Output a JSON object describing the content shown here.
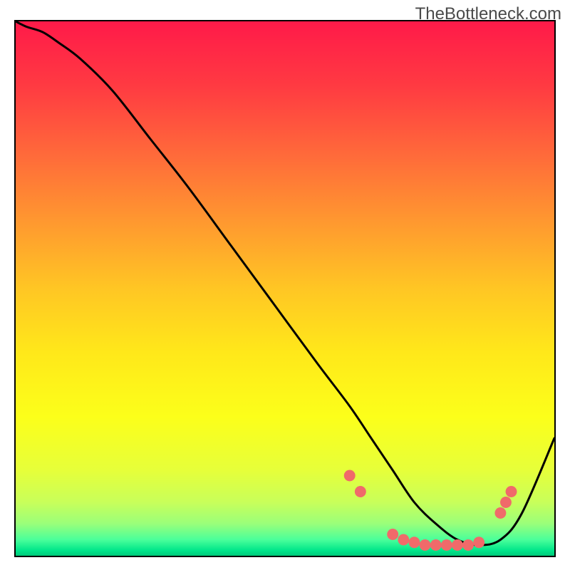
{
  "watermark": "TheBottleneck.com",
  "chart_data": {
    "type": "line",
    "title": "",
    "xlabel": "",
    "ylabel": "",
    "xlim": [
      0,
      100
    ],
    "ylim": [
      0,
      100
    ],
    "gradient_stops": [
      {
        "pos": 0,
        "color": "#ff1a49"
      },
      {
        "pos": 12,
        "color": "#ff3a42"
      },
      {
        "pos": 25,
        "color": "#ff6a3a"
      },
      {
        "pos": 38,
        "color": "#ff9a2f"
      },
      {
        "pos": 50,
        "color": "#ffc624"
      },
      {
        "pos": 62,
        "color": "#ffe81a"
      },
      {
        "pos": 74,
        "color": "#fcff1a"
      },
      {
        "pos": 84,
        "color": "#e6ff3a"
      },
      {
        "pos": 90,
        "color": "#c8ff5a"
      },
      {
        "pos": 94,
        "color": "#9aff7a"
      },
      {
        "pos": 97,
        "color": "#4aff9a"
      },
      {
        "pos": 99,
        "color": "#00e68a"
      },
      {
        "pos": 100,
        "color": "#00c97a"
      }
    ],
    "series": [
      {
        "name": "bottleneck-curve",
        "x": [
          0,
          2,
          5,
          8,
          12,
          18,
          25,
          32,
          40,
          48,
          56,
          62,
          66,
          70,
          74,
          78,
          82,
          86,
          90,
          94,
          100
        ],
        "y": [
          100,
          99,
          98,
          96,
          93,
          87,
          78,
          69,
          58,
          47,
          36,
          28,
          22,
          16,
          10,
          6,
          3,
          2,
          3,
          8,
          22
        ]
      }
    ],
    "markers": {
      "name": "highlight-dots",
      "color": "#f06a6a",
      "points": [
        {
          "x": 62,
          "y": 15
        },
        {
          "x": 64,
          "y": 12
        },
        {
          "x": 70,
          "y": 4
        },
        {
          "x": 72,
          "y": 3
        },
        {
          "x": 74,
          "y": 2.5
        },
        {
          "x": 76,
          "y": 2
        },
        {
          "x": 78,
          "y": 2
        },
        {
          "x": 80,
          "y": 2
        },
        {
          "x": 82,
          "y": 2
        },
        {
          "x": 84,
          "y": 2
        },
        {
          "x": 86,
          "y": 2.5
        },
        {
          "x": 90,
          "y": 8
        },
        {
          "x": 91,
          "y": 10
        },
        {
          "x": 92,
          "y": 12
        }
      ]
    }
  }
}
